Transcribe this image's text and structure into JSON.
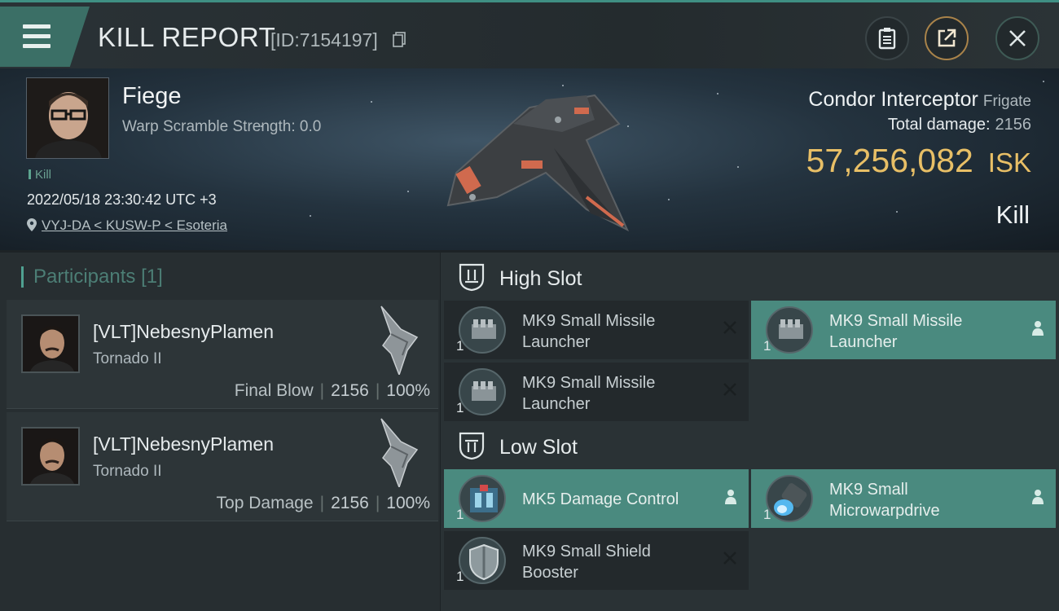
{
  "header": {
    "title": "KILL REPORT",
    "report_id": "[ID:7154197]",
    "icons": [
      "menu-icon",
      "copy-icon",
      "clipboard-icon",
      "share-icon",
      "close-icon"
    ]
  },
  "victim": {
    "name": "Fiege",
    "warp_scramble": "Warp Scramble Strength: 0.0",
    "kill_tag": "Kill",
    "datetime": "2022/05/18 23:30:42 UTC +3",
    "location": "VYJ-DA < KUSW-P < Esoteria",
    "ship_name": "Condor Interceptor",
    "ship_class": "Frigate",
    "total_damage_label": "Total damage:",
    "total_damage_value": "2156",
    "isk_amount": "57,256,082",
    "isk_unit": "ISK",
    "result": "Kill"
  },
  "participants": {
    "heading": "Participants",
    "count": "[1]",
    "rows": [
      {
        "name": "[VLT]NebesnyPlamen",
        "ship": "Tornado II",
        "role": "Final Blow",
        "damage": "2156",
        "percent": "100%"
      },
      {
        "name": "[VLT]NebesnyPlamen",
        "ship": "Tornado II",
        "role": "Top Damage",
        "damage": "2156",
        "percent": "100%"
      }
    ]
  },
  "slots": {
    "high": {
      "label": "High Slot",
      "modules": [
        {
          "name": "MK9 Small Missile Launcher",
          "qty": "1",
          "status": "destroyed"
        },
        {
          "name": "MK9 Small Missile Launcher",
          "qty": "1",
          "status": "dropped"
        },
        {
          "name": "MK9 Small Missile Launcher",
          "qty": "1",
          "status": "destroyed"
        }
      ]
    },
    "low": {
      "label": "Low Slot",
      "modules": [
        {
          "name": "MK5 Damage Control",
          "qty": "1",
          "status": "dropped"
        },
        {
          "name": "MK9 Small Microwarpdrive",
          "qty": "1",
          "status": "dropped"
        },
        {
          "name": "MK9 Small Shield Booster",
          "qty": "1",
          "status": "destroyed"
        }
      ]
    }
  },
  "colors": {
    "accent": "#4fa191",
    "isk": "#e8bf66",
    "active_module": "#4a8a7f"
  }
}
